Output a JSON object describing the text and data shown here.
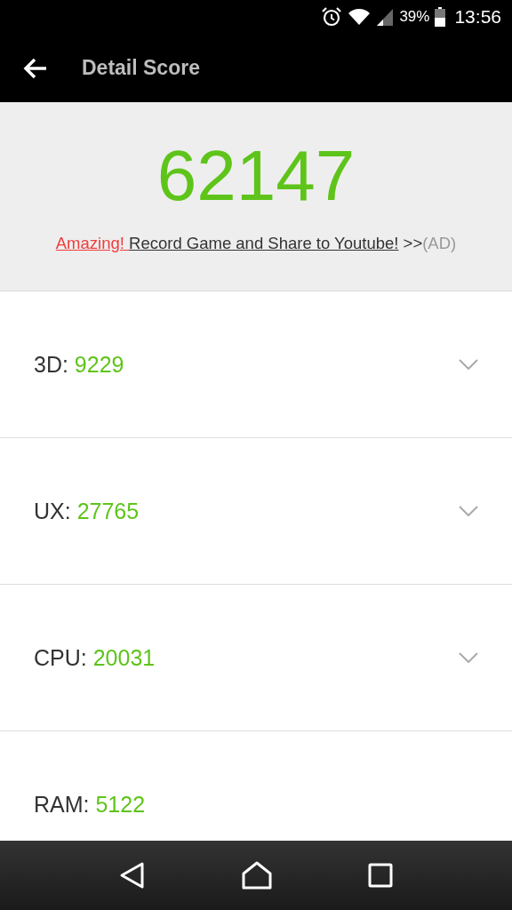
{
  "status_bar": {
    "battery": "39%",
    "time": "13:56"
  },
  "app_bar": {
    "title": "Detail Score"
  },
  "total": {
    "score": "62147",
    "promo": {
      "highlight": "Amazing! ",
      "link": "Record Game and Share to Youtube!",
      "arrows": " >>",
      "tag": "(AD)"
    }
  },
  "scores": [
    {
      "label": "3D:",
      "value": "9229",
      "kind": "expandable"
    },
    {
      "label": "UX:",
      "value": "27765",
      "kind": "expandable"
    },
    {
      "label": "CPU:",
      "value": "20031",
      "kind": "expandable"
    },
    {
      "label": "RAM:",
      "value": "5122",
      "kind": "plain"
    }
  ]
}
